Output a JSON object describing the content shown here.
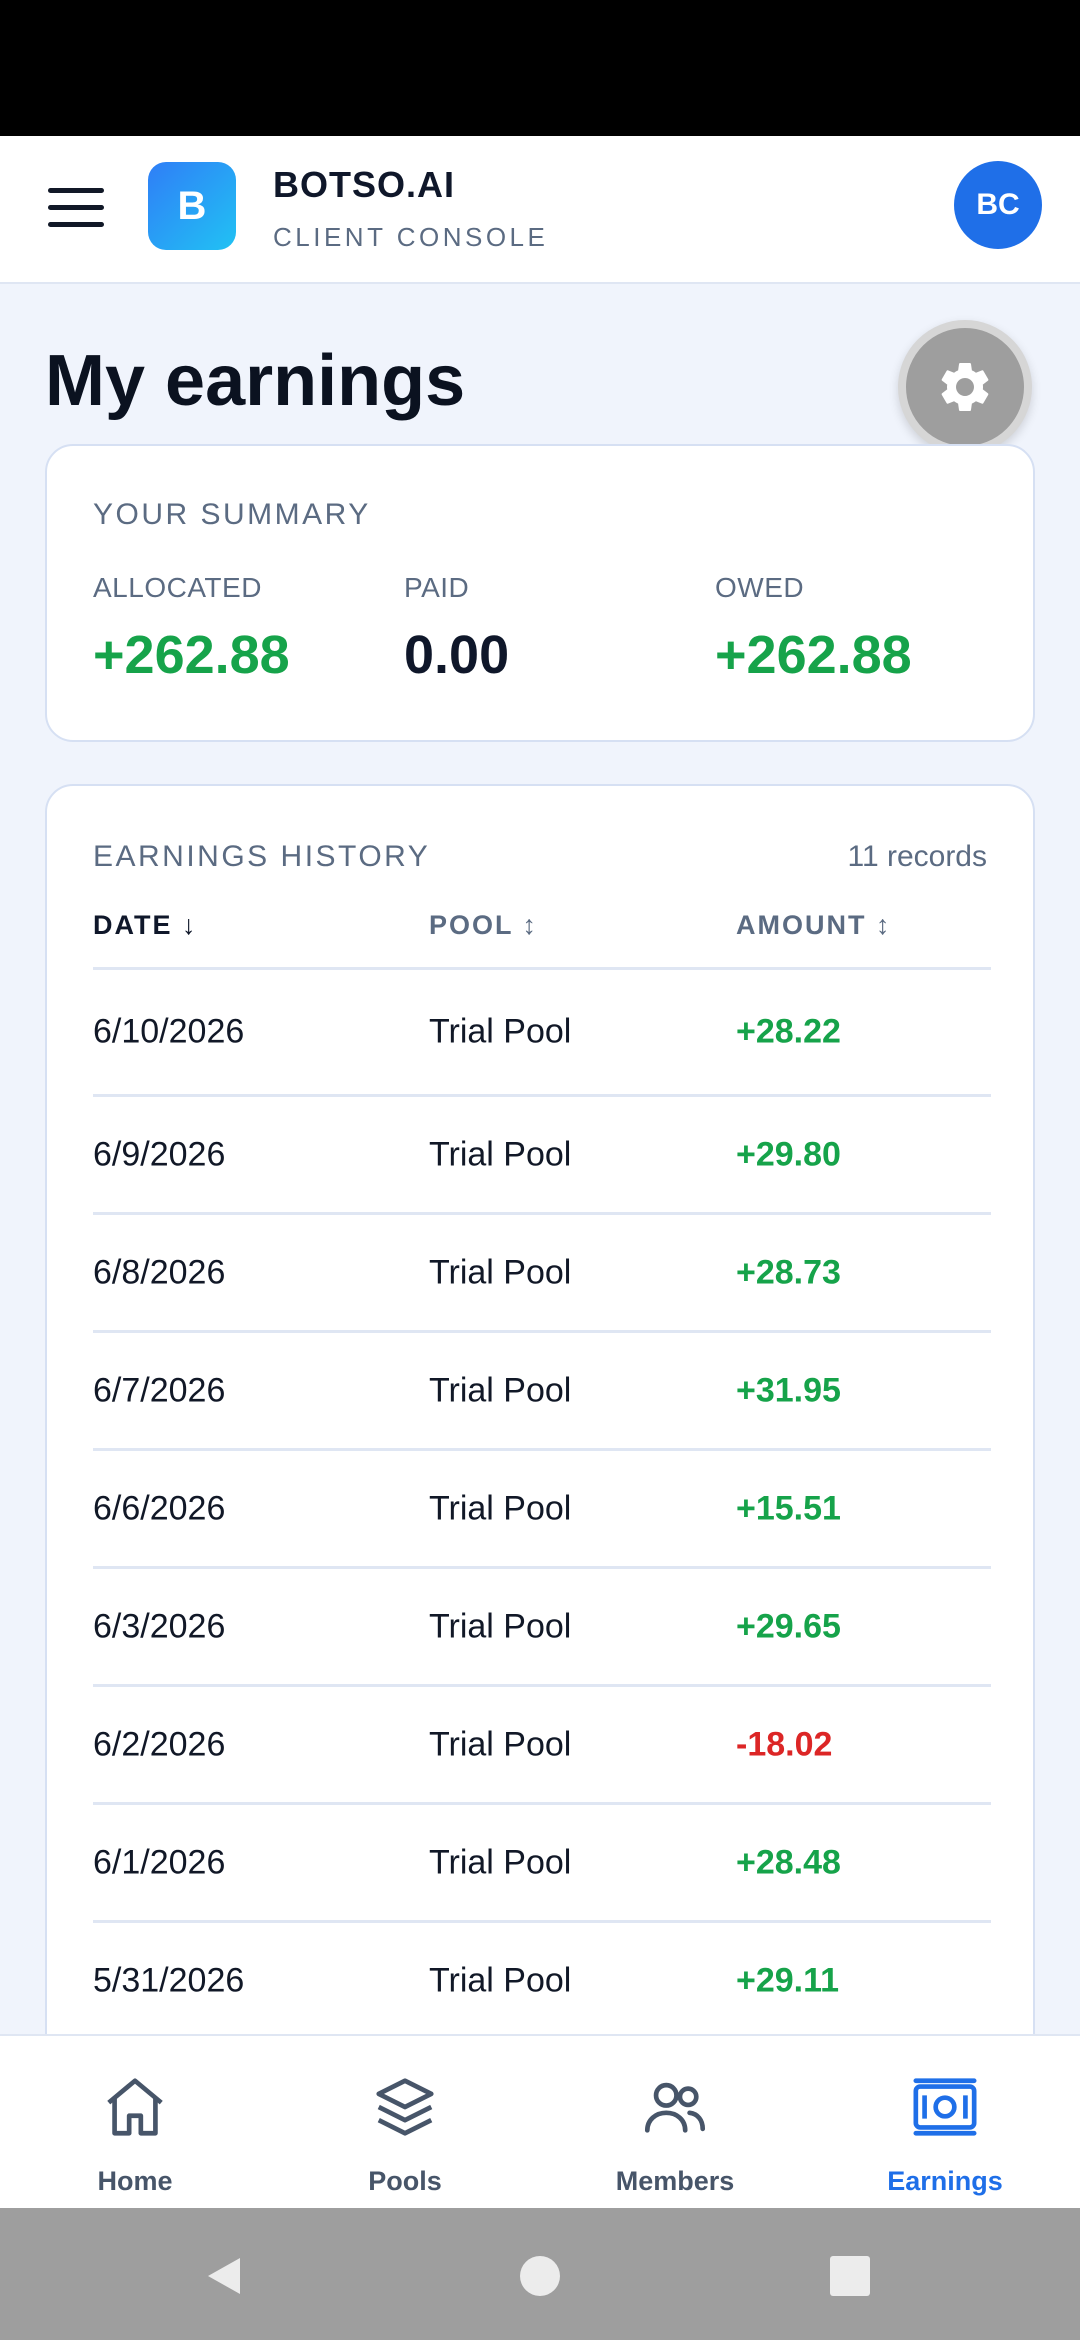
{
  "header": {
    "logo_letter": "B",
    "brand_name": "BOTSO.AI",
    "brand_sub": "CLIENT CONSOLE",
    "avatar_initials": "BC"
  },
  "page": {
    "title": "My earnings"
  },
  "summary": {
    "label": "YOUR SUMMARY",
    "allocated_label": "ALLOCATED",
    "allocated_value": "+262.88",
    "paid_label": "PAID",
    "paid_value": "0.00",
    "owed_label": "OWED",
    "owed_value": "+262.88"
  },
  "history": {
    "label": "EARNINGS HISTORY",
    "record_count": "11 records",
    "columns": {
      "date": "DATE ↓",
      "pool": "POOL ↕",
      "amount": "AMOUNT ↕"
    },
    "rows": [
      {
        "date": "6/10/2026",
        "pool": "Trial Pool",
        "amount": "+28.22"
      },
      {
        "date": "6/9/2026",
        "pool": "Trial Pool",
        "amount": "+29.80"
      },
      {
        "date": "6/8/2026",
        "pool": "Trial Pool",
        "amount": "+28.73"
      },
      {
        "date": "6/7/2026",
        "pool": "Trial Pool",
        "amount": "+31.95"
      },
      {
        "date": "6/6/2026",
        "pool": "Trial Pool",
        "amount": "+15.51"
      },
      {
        "date": "6/3/2026",
        "pool": "Trial Pool",
        "amount": "+29.65"
      },
      {
        "date": "6/2/2026",
        "pool": "Trial Pool",
        "amount": "-18.02"
      },
      {
        "date": "6/1/2026",
        "pool": "Trial Pool",
        "amount": "+28.48"
      },
      {
        "date": "5/31/2026",
        "pool": "Trial Pool",
        "amount": "+29.11"
      }
    ]
  },
  "nav": {
    "home": "Home",
    "pools": "Pools",
    "members": "Members",
    "earnings": "Earnings",
    "active": "earnings"
  },
  "colors": {
    "accent": "#1f6fe8",
    "positive": "#16a34a",
    "negative": "#dc2626"
  }
}
